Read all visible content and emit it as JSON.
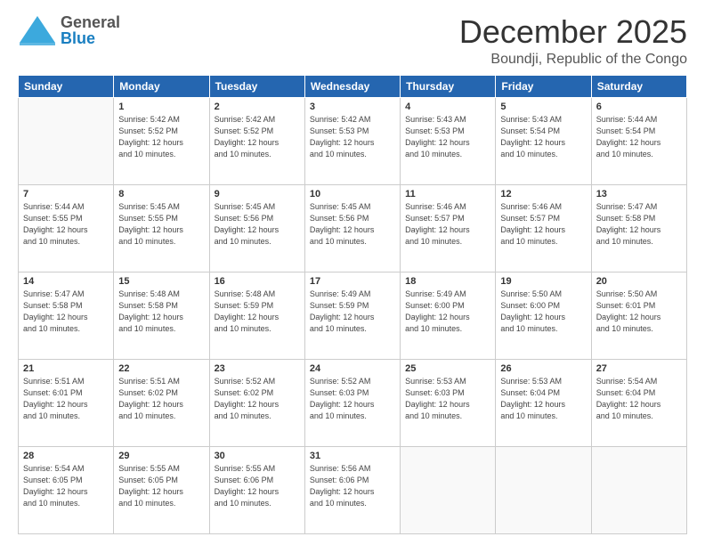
{
  "header": {
    "logo_general": "General",
    "logo_blue": "Blue",
    "main_title": "December 2025",
    "subtitle": "Boundji, Republic of the Congo"
  },
  "calendar": {
    "days_of_week": [
      "Sunday",
      "Monday",
      "Tuesday",
      "Wednesday",
      "Thursday",
      "Friday",
      "Saturday"
    ],
    "weeks": [
      [
        {
          "num": "",
          "info": ""
        },
        {
          "num": "1",
          "info": "Sunrise: 5:42 AM\nSunset: 5:52 PM\nDaylight: 12 hours\nand 10 minutes."
        },
        {
          "num": "2",
          "info": "Sunrise: 5:42 AM\nSunset: 5:52 PM\nDaylight: 12 hours\nand 10 minutes."
        },
        {
          "num": "3",
          "info": "Sunrise: 5:42 AM\nSunset: 5:53 PM\nDaylight: 12 hours\nand 10 minutes."
        },
        {
          "num": "4",
          "info": "Sunrise: 5:43 AM\nSunset: 5:53 PM\nDaylight: 12 hours\nand 10 minutes."
        },
        {
          "num": "5",
          "info": "Sunrise: 5:43 AM\nSunset: 5:54 PM\nDaylight: 12 hours\nand 10 minutes."
        },
        {
          "num": "6",
          "info": "Sunrise: 5:44 AM\nSunset: 5:54 PM\nDaylight: 12 hours\nand 10 minutes."
        }
      ],
      [
        {
          "num": "7",
          "info": "Sunrise: 5:44 AM\nSunset: 5:55 PM\nDaylight: 12 hours\nand 10 minutes."
        },
        {
          "num": "8",
          "info": "Sunrise: 5:45 AM\nSunset: 5:55 PM\nDaylight: 12 hours\nand 10 minutes."
        },
        {
          "num": "9",
          "info": "Sunrise: 5:45 AM\nSunset: 5:56 PM\nDaylight: 12 hours\nand 10 minutes."
        },
        {
          "num": "10",
          "info": "Sunrise: 5:45 AM\nSunset: 5:56 PM\nDaylight: 12 hours\nand 10 minutes."
        },
        {
          "num": "11",
          "info": "Sunrise: 5:46 AM\nSunset: 5:57 PM\nDaylight: 12 hours\nand 10 minutes."
        },
        {
          "num": "12",
          "info": "Sunrise: 5:46 AM\nSunset: 5:57 PM\nDaylight: 12 hours\nand 10 minutes."
        },
        {
          "num": "13",
          "info": "Sunrise: 5:47 AM\nSunset: 5:58 PM\nDaylight: 12 hours\nand 10 minutes."
        }
      ],
      [
        {
          "num": "14",
          "info": "Sunrise: 5:47 AM\nSunset: 5:58 PM\nDaylight: 12 hours\nand 10 minutes."
        },
        {
          "num": "15",
          "info": "Sunrise: 5:48 AM\nSunset: 5:58 PM\nDaylight: 12 hours\nand 10 minutes."
        },
        {
          "num": "16",
          "info": "Sunrise: 5:48 AM\nSunset: 5:59 PM\nDaylight: 12 hours\nand 10 minutes."
        },
        {
          "num": "17",
          "info": "Sunrise: 5:49 AM\nSunset: 5:59 PM\nDaylight: 12 hours\nand 10 minutes."
        },
        {
          "num": "18",
          "info": "Sunrise: 5:49 AM\nSunset: 6:00 PM\nDaylight: 12 hours\nand 10 minutes."
        },
        {
          "num": "19",
          "info": "Sunrise: 5:50 AM\nSunset: 6:00 PM\nDaylight: 12 hours\nand 10 minutes."
        },
        {
          "num": "20",
          "info": "Sunrise: 5:50 AM\nSunset: 6:01 PM\nDaylight: 12 hours\nand 10 minutes."
        }
      ],
      [
        {
          "num": "21",
          "info": "Sunrise: 5:51 AM\nSunset: 6:01 PM\nDaylight: 12 hours\nand 10 minutes."
        },
        {
          "num": "22",
          "info": "Sunrise: 5:51 AM\nSunset: 6:02 PM\nDaylight: 12 hours\nand 10 minutes."
        },
        {
          "num": "23",
          "info": "Sunrise: 5:52 AM\nSunset: 6:02 PM\nDaylight: 12 hours\nand 10 minutes."
        },
        {
          "num": "24",
          "info": "Sunrise: 5:52 AM\nSunset: 6:03 PM\nDaylight: 12 hours\nand 10 minutes."
        },
        {
          "num": "25",
          "info": "Sunrise: 5:53 AM\nSunset: 6:03 PM\nDaylight: 12 hours\nand 10 minutes."
        },
        {
          "num": "26",
          "info": "Sunrise: 5:53 AM\nSunset: 6:04 PM\nDaylight: 12 hours\nand 10 minutes."
        },
        {
          "num": "27",
          "info": "Sunrise: 5:54 AM\nSunset: 6:04 PM\nDaylight: 12 hours\nand 10 minutes."
        }
      ],
      [
        {
          "num": "28",
          "info": "Sunrise: 5:54 AM\nSunset: 6:05 PM\nDaylight: 12 hours\nand 10 minutes."
        },
        {
          "num": "29",
          "info": "Sunrise: 5:55 AM\nSunset: 6:05 PM\nDaylight: 12 hours\nand 10 minutes."
        },
        {
          "num": "30",
          "info": "Sunrise: 5:55 AM\nSunset: 6:06 PM\nDaylight: 12 hours\nand 10 minutes."
        },
        {
          "num": "31",
          "info": "Sunrise: 5:56 AM\nSunset: 6:06 PM\nDaylight: 12 hours\nand 10 minutes."
        },
        {
          "num": "",
          "info": ""
        },
        {
          "num": "",
          "info": ""
        },
        {
          "num": "",
          "info": ""
        }
      ]
    ]
  }
}
